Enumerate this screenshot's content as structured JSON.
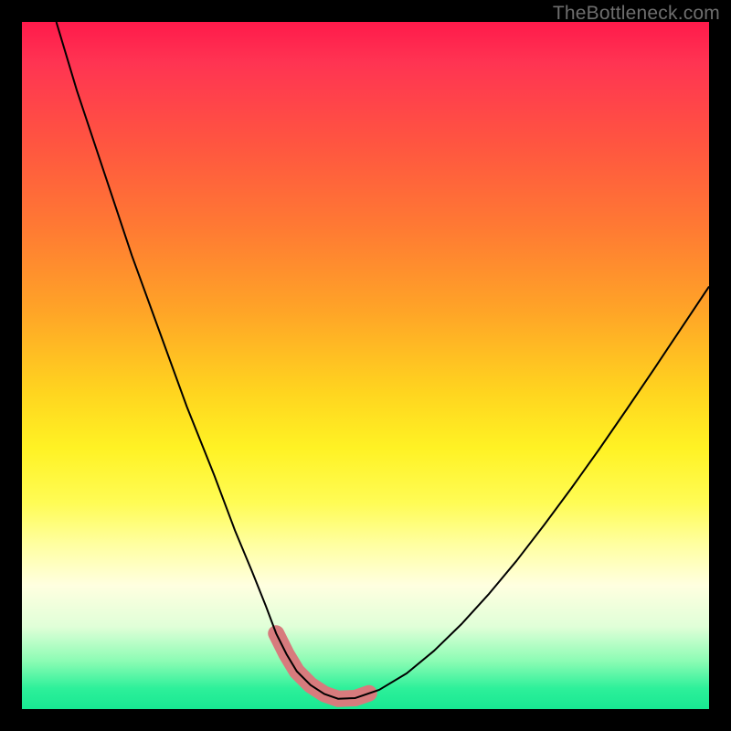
{
  "watermark": "TheBottleneck.com",
  "chart_data": {
    "type": "line",
    "title": "",
    "xlabel": "",
    "ylabel": "",
    "xlim": [
      0,
      100
    ],
    "ylim": [
      0,
      100
    ],
    "series": [
      {
        "name": "black-curve",
        "color": "#000000",
        "stroke_width": 2,
        "x": [
          5,
          8,
          12,
          16,
          20,
          24,
          28,
          31,
          33.5,
          35.5,
          37,
          38.5,
          40,
          42,
          44,
          46,
          48.5,
          52,
          56,
          60,
          64,
          68,
          72,
          76,
          80,
          84,
          88,
          92,
          96,
          100
        ],
        "y": [
          100,
          90,
          78,
          66,
          55,
          44,
          34,
          26,
          20,
          15,
          11,
          8,
          5.5,
          3.5,
          2.2,
          1.5,
          1.6,
          2.8,
          5.2,
          8.5,
          12.4,
          16.8,
          21.6,
          26.8,
          32.2,
          37.8,
          43.6,
          49.5,
          55.5,
          61.5
        ]
      },
      {
        "name": "pink-highlight",
        "color": "#d77b7d",
        "stroke_width": 18,
        "linecap": "round",
        "x": [
          37,
          38.5,
          40,
          42,
          44,
          46,
          48.5,
          50.5
        ],
        "y": [
          11,
          8,
          5.5,
          3.5,
          2.2,
          1.5,
          1.6,
          2.3
        ]
      }
    ]
  }
}
